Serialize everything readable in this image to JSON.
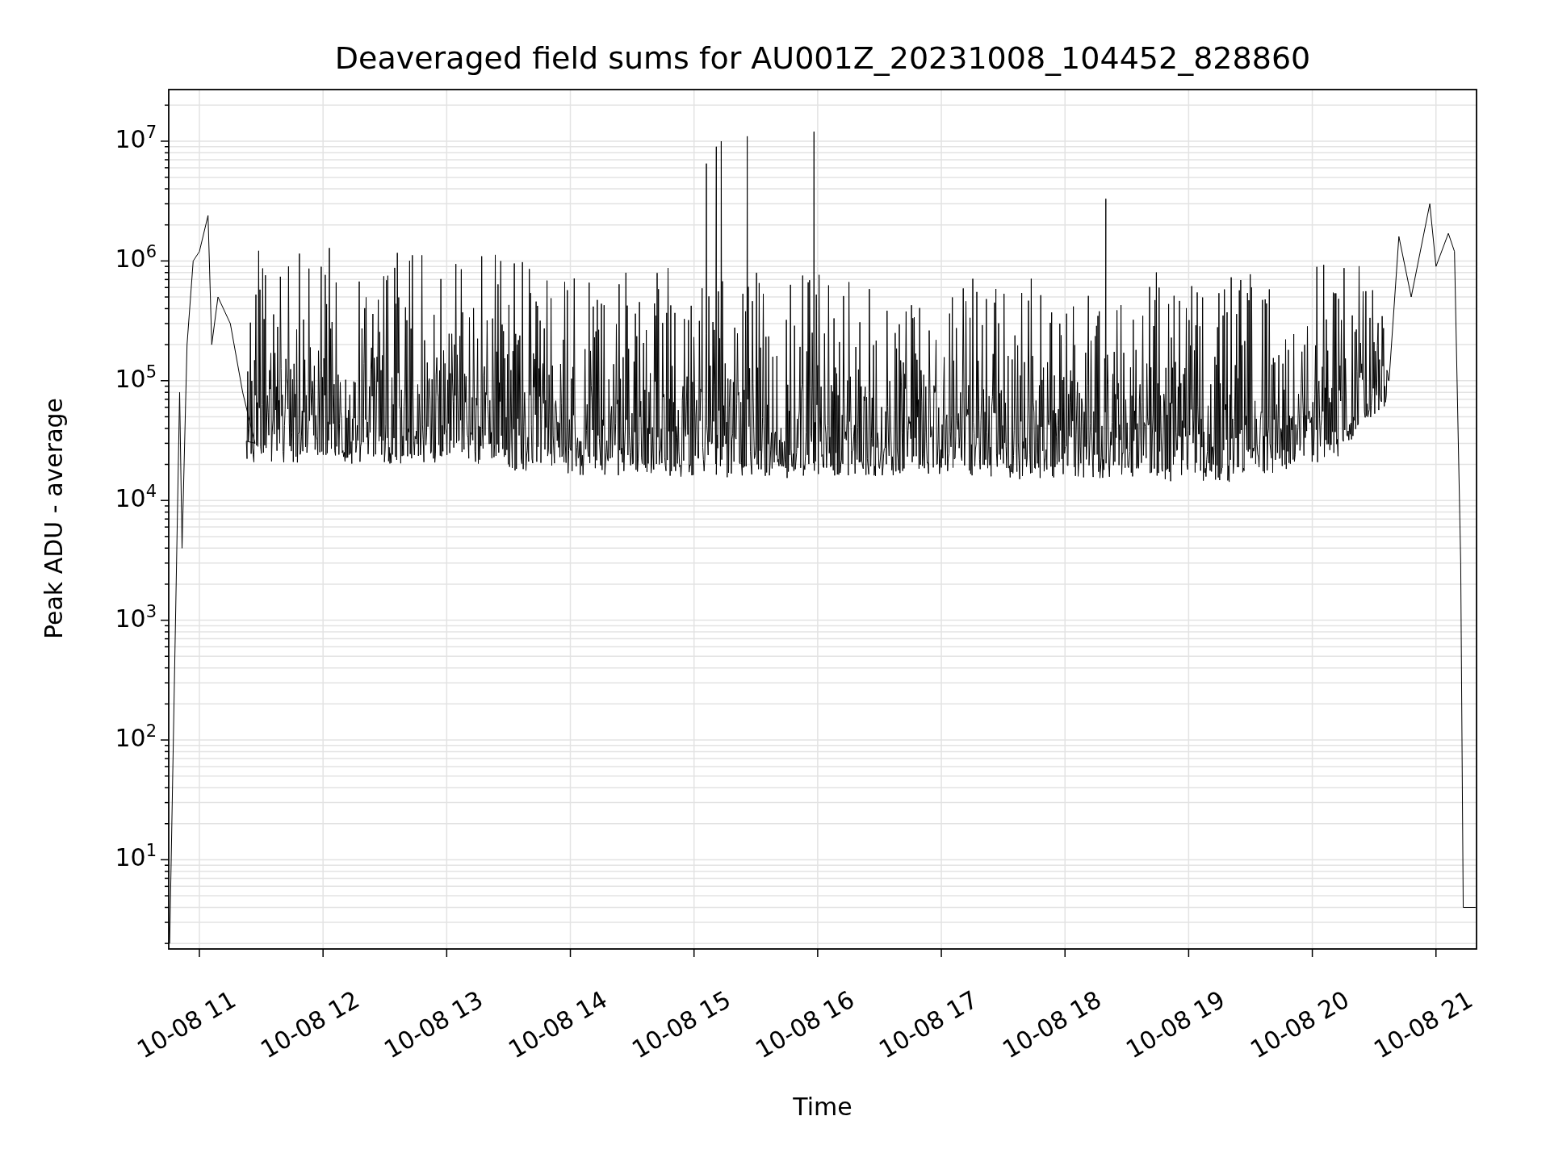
{
  "figure": {
    "title": "Deaveraged field sums for AU001Z_20231008_104452_828860",
    "y_axis": {
      "label": "Peak ADU - average",
      "tick_labels": [
        "10$^{7}$",
        "10$^{6}$",
        "10$^{5}$",
        "10$^{4}$",
        "10$^{3}$",
        "10$^{2}$",
        "10$^{1}$"
      ]
    },
    "x_axis": {
      "label": "Time",
      "tick_labels": [
        "10-08 11",
        "10-08 12",
        "10-08 13",
        "10-08 14",
        "10-08 15",
        "10-08 16",
        "10-08 17",
        "10-08 18",
        "10-08 19",
        "10-08 20",
        "10-08 21"
      ]
    }
  }
}
